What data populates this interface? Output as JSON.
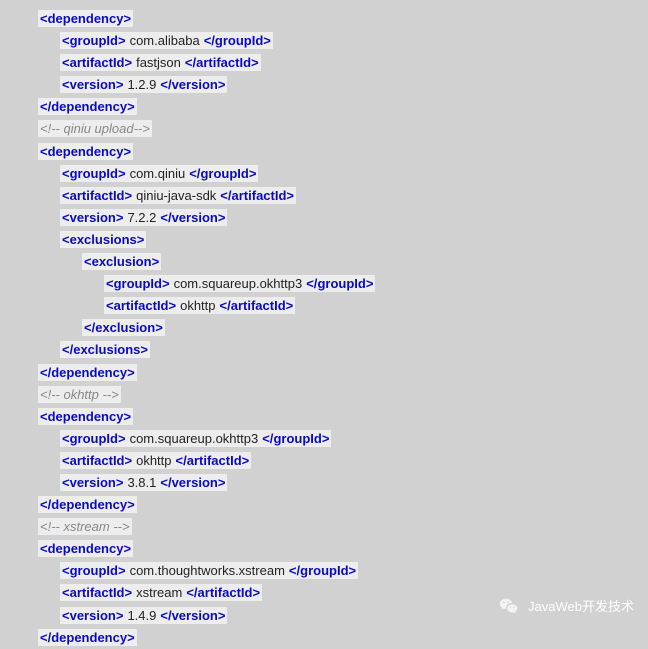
{
  "lines": [
    {
      "indent": 1,
      "type": "open",
      "tag": "dependency"
    },
    {
      "indent": 2,
      "type": "full",
      "tag": "groupId",
      "text": "com.alibaba"
    },
    {
      "indent": 2,
      "type": "full",
      "tag": "artifactId",
      "text": "fastjson"
    },
    {
      "indent": 2,
      "type": "full",
      "tag": "version",
      "text": "1.2.9"
    },
    {
      "indent": 1,
      "type": "close",
      "tag": "dependency"
    },
    {
      "indent": 1,
      "type": "comment",
      "text": "<!-- qiniu upload-->"
    },
    {
      "indent": 1,
      "type": "open",
      "tag": "dependency"
    },
    {
      "indent": 2,
      "type": "full",
      "tag": "groupId",
      "text": "com.qiniu"
    },
    {
      "indent": 2,
      "type": "full",
      "tag": "artifactId",
      "text": "qiniu-java-sdk"
    },
    {
      "indent": 2,
      "type": "full",
      "tag": "version",
      "text": "7.2.2"
    },
    {
      "indent": 2,
      "type": "open",
      "tag": "exclusions"
    },
    {
      "indent": 3,
      "type": "open",
      "tag": "exclusion"
    },
    {
      "indent": 4,
      "type": "full",
      "tag": "groupId",
      "text": "com.squareup.okhttp3"
    },
    {
      "indent": 4,
      "type": "full",
      "tag": "artifactId",
      "text": "okhttp"
    },
    {
      "indent": 3,
      "type": "close",
      "tag": "exclusion"
    },
    {
      "indent": 2,
      "type": "close",
      "tag": "exclusions"
    },
    {
      "indent": 1,
      "type": "close",
      "tag": "dependency"
    },
    {
      "indent": 1,
      "type": "comment",
      "text": "<!-- okhttp -->"
    },
    {
      "indent": 1,
      "type": "open",
      "tag": "dependency"
    },
    {
      "indent": 2,
      "type": "full",
      "tag": "groupId",
      "text": "com.squareup.okhttp3"
    },
    {
      "indent": 2,
      "type": "full",
      "tag": "artifactId",
      "text": "okhttp"
    },
    {
      "indent": 2,
      "type": "full",
      "tag": "version",
      "text": "3.8.1"
    },
    {
      "indent": 1,
      "type": "close",
      "tag": "dependency"
    },
    {
      "indent": 1,
      "type": "comment",
      "text": "<!-- xstream -->"
    },
    {
      "indent": 1,
      "type": "open",
      "tag": "dependency"
    },
    {
      "indent": 2,
      "type": "full",
      "tag": "groupId",
      "text": "com.thoughtworks.xstream"
    },
    {
      "indent": 2,
      "type": "full",
      "tag": "artifactId",
      "text": "xstream"
    },
    {
      "indent": 2,
      "type": "full",
      "tag": "version",
      "text": "1.4.9"
    },
    {
      "indent": 1,
      "type": "close",
      "tag": "dependency"
    }
  ],
  "watermark": {
    "text": "JavaWeb开发技术"
  }
}
